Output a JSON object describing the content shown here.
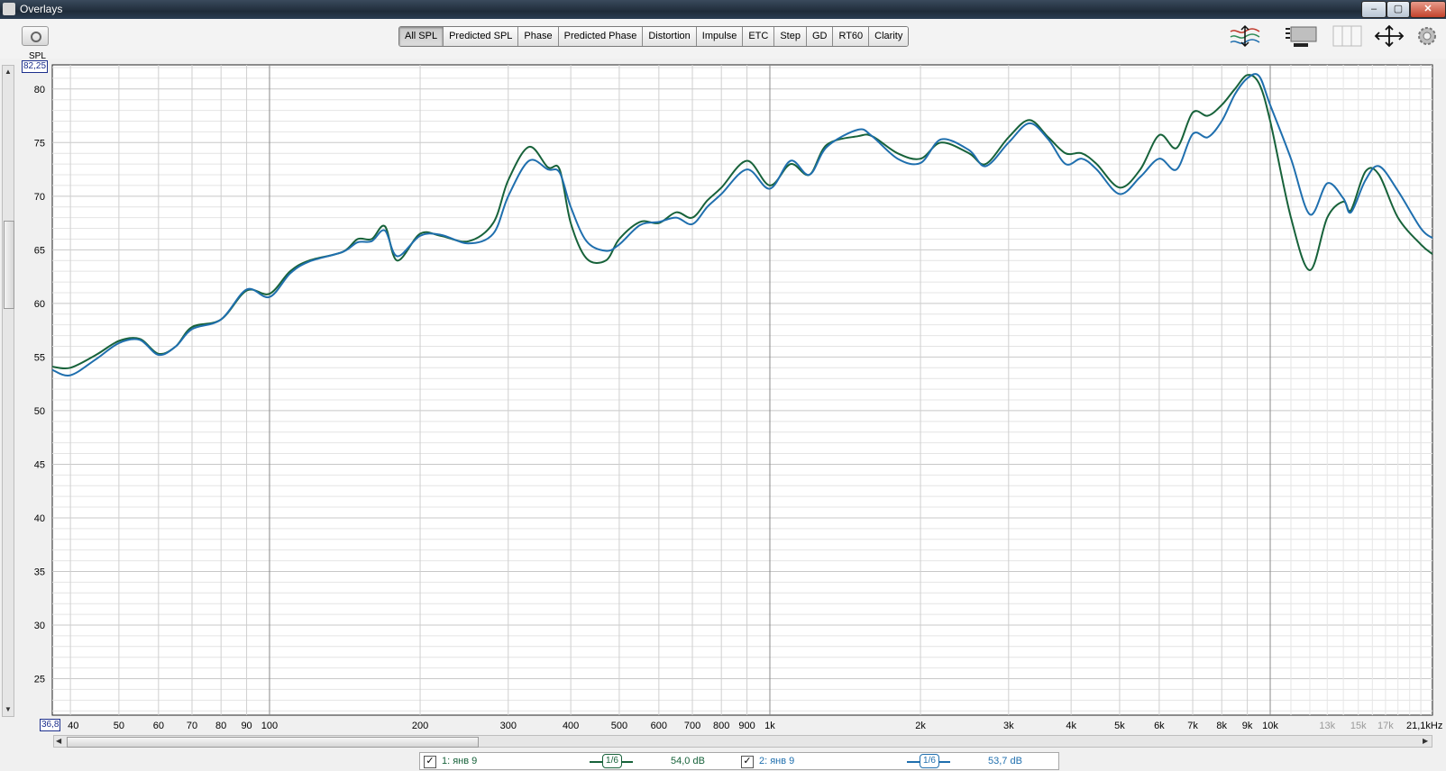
{
  "window": {
    "title": "Overlays",
    "minimize": "–",
    "maximize": "▢",
    "close": "✕"
  },
  "tabs": [
    {
      "label": "All SPL",
      "active": true
    },
    {
      "label": "Predicted SPL"
    },
    {
      "label": "Phase"
    },
    {
      "label": "Predicted Phase"
    },
    {
      "label": "Distortion"
    },
    {
      "label": "Impulse"
    },
    {
      "label": "ETC"
    },
    {
      "label": "Step"
    },
    {
      "label": "GD"
    },
    {
      "label": "RT60"
    },
    {
      "label": "Clarity"
    }
  ],
  "toolbar_icons": [
    "camera-icon",
    "trace-arrange-icon",
    "controls-panel-icon",
    "columns-icon",
    "fit-arrows-icon",
    "gear-icon"
  ],
  "y_axis": {
    "label": "SPL",
    "top_value": "82,25"
  },
  "x_axis": {
    "start_value": "36,8",
    "end_label": "21,1kHz"
  },
  "legend": [
    {
      "checked": true,
      "name": "1: янв 9",
      "smoothing": "1/6",
      "level": "54,0 dB",
      "color": "#17623a"
    },
    {
      "checked": true,
      "name": "2: янв 9",
      "smoothing": "1/6",
      "level": "53,7 dB",
      "color": "#1f6fae"
    }
  ],
  "chart_data": {
    "type": "line",
    "x_scale": "log",
    "xlim": [
      36.8,
      21100
    ],
    "ylim": [
      21.6,
      82.25
    ],
    "y_ticks": [
      25,
      30,
      35,
      40,
      45,
      50,
      55,
      60,
      65,
      70,
      75,
      80
    ],
    "x_tick_labels": [
      {
        "v": 40,
        "t": "40"
      },
      {
        "v": 50,
        "t": "50"
      },
      {
        "v": 60,
        "t": "60"
      },
      {
        "v": 70,
        "t": "70"
      },
      {
        "v": 80,
        "t": "80"
      },
      {
        "v": 90,
        "t": "90"
      },
      {
        "v": 100,
        "t": "100"
      },
      {
        "v": 200,
        "t": "200"
      },
      {
        "v": 300,
        "t": "300"
      },
      {
        "v": 400,
        "t": "400"
      },
      {
        "v": 500,
        "t": "500"
      },
      {
        "v": 600,
        "t": "600"
      },
      {
        "v": 700,
        "t": "700"
      },
      {
        "v": 800,
        "t": "800"
      },
      {
        "v": 900,
        "t": "900"
      },
      {
        "v": 1000,
        "t": "1k"
      },
      {
        "v": 2000,
        "t": "2k"
      },
      {
        "v": 3000,
        "t": "3k"
      },
      {
        "v": 4000,
        "t": "4k"
      },
      {
        "v": 5000,
        "t": "5k"
      },
      {
        "v": 6000,
        "t": "6k"
      },
      {
        "v": 7000,
        "t": "7k"
      },
      {
        "v": 8000,
        "t": "8k"
      },
      {
        "v": 9000,
        "t": "9k"
      },
      {
        "v": 10000,
        "t": "10k"
      },
      {
        "v": 13000,
        "t": "13k",
        "dim": true
      },
      {
        "v": 15000,
        "t": "15k",
        "dim": true
      },
      {
        "v": 17000,
        "t": "17k",
        "dim": true
      }
    ],
    "series": [
      {
        "name": "1: янв 9",
        "color": "#17623a",
        "points": [
          [
            36.8,
            54.1
          ],
          [
            40,
            54.0
          ],
          [
            45,
            55.2
          ],
          [
            50,
            56.5
          ],
          [
            55,
            56.7
          ],
          [
            60,
            55.3
          ],
          [
            65,
            56.0
          ],
          [
            70,
            57.8
          ],
          [
            80,
            58.5
          ],
          [
            90,
            61.2
          ],
          [
            100,
            60.9
          ],
          [
            110,
            63.0
          ],
          [
            120,
            64.0
          ],
          [
            140,
            64.8
          ],
          [
            150,
            66.0
          ],
          [
            160,
            66.0
          ],
          [
            170,
            67.2
          ],
          [
            180,
            64.0
          ],
          [
            200,
            66.5
          ],
          [
            220,
            66.3
          ],
          [
            250,
            65.8
          ],
          [
            280,
            67.5
          ],
          [
            300,
            71.5
          ],
          [
            330,
            74.6
          ],
          [
            360,
            72.7
          ],
          [
            380,
            72.5
          ],
          [
            400,
            67.5
          ],
          [
            430,
            64.2
          ],
          [
            470,
            64.0
          ],
          [
            500,
            66.0
          ],
          [
            550,
            67.6
          ],
          [
            600,
            67.5
          ],
          [
            650,
            68.5
          ],
          [
            700,
            68.0
          ],
          [
            750,
            69.6
          ],
          [
            800,
            70.8
          ],
          [
            900,
            73.3
          ],
          [
            1000,
            71.0
          ],
          [
            1100,
            73.0
          ],
          [
            1200,
            72.0
          ],
          [
            1300,
            74.8
          ],
          [
            1500,
            75.6
          ],
          [
            1600,
            75.6
          ],
          [
            1800,
            74.0
          ],
          [
            2000,
            73.5
          ],
          [
            2200,
            75.0
          ],
          [
            2500,
            74.0
          ],
          [
            2700,
            73.0
          ],
          [
            3000,
            75.5
          ],
          [
            3300,
            77.1
          ],
          [
            3600,
            75.5
          ],
          [
            3900,
            74.0
          ],
          [
            4200,
            74.0
          ],
          [
            4500,
            73.0
          ],
          [
            5000,
            70.8
          ],
          [
            5500,
            72.5
          ],
          [
            6000,
            75.7
          ],
          [
            6500,
            74.5
          ],
          [
            7000,
            77.8
          ],
          [
            7500,
            77.5
          ],
          [
            8000,
            78.5
          ],
          [
            8500,
            80.0
          ],
          [
            9000,
            81.3
          ],
          [
            9500,
            80.5
          ],
          [
            10000,
            77.0
          ],
          [
            11000,
            68.0
          ],
          [
            12000,
            63.1
          ],
          [
            13000,
            68.0
          ],
          [
            14000,
            69.5
          ],
          [
            14500,
            68.7
          ],
          [
            15500,
            72.3
          ],
          [
            16500,
            72.0
          ],
          [
            18000,
            68.0
          ],
          [
            20000,
            65.5
          ],
          [
            21100,
            64.6
          ]
        ]
      },
      {
        "name": "2: янв 9",
        "color": "#1f6fae",
        "points": [
          [
            36.8,
            53.8
          ],
          [
            40,
            53.3
          ],
          [
            45,
            54.8
          ],
          [
            50,
            56.3
          ],
          [
            55,
            56.6
          ],
          [
            60,
            55.2
          ],
          [
            65,
            56.0
          ],
          [
            70,
            57.6
          ],
          [
            80,
            58.5
          ],
          [
            90,
            61.3
          ],
          [
            100,
            60.6
          ],
          [
            110,
            62.8
          ],
          [
            120,
            63.9
          ],
          [
            140,
            64.8
          ],
          [
            150,
            65.7
          ],
          [
            160,
            65.8
          ],
          [
            170,
            66.8
          ],
          [
            180,
            64.4
          ],
          [
            200,
            66.3
          ],
          [
            220,
            66.4
          ],
          [
            250,
            65.6
          ],
          [
            280,
            66.5
          ],
          [
            300,
            70.0
          ],
          [
            330,
            73.3
          ],
          [
            360,
            72.5
          ],
          [
            380,
            72.2
          ],
          [
            400,
            69.0
          ],
          [
            430,
            65.8
          ],
          [
            470,
            64.9
          ],
          [
            500,
            65.5
          ],
          [
            550,
            67.3
          ],
          [
            600,
            67.6
          ],
          [
            650,
            68.0
          ],
          [
            700,
            67.4
          ],
          [
            750,
            69.0
          ],
          [
            800,
            70.2
          ],
          [
            900,
            72.5
          ],
          [
            1000,
            70.7
          ],
          [
            1100,
            73.3
          ],
          [
            1200,
            72.0
          ],
          [
            1300,
            74.6
          ],
          [
            1500,
            76.2
          ],
          [
            1600,
            75.6
          ],
          [
            1800,
            73.5
          ],
          [
            2000,
            73.1
          ],
          [
            2200,
            75.3
          ],
          [
            2500,
            74.3
          ],
          [
            2700,
            72.8
          ],
          [
            3000,
            75.0
          ],
          [
            3300,
            76.8
          ],
          [
            3600,
            75.3
          ],
          [
            3900,
            73.0
          ],
          [
            4200,
            73.5
          ],
          [
            4500,
            72.5
          ],
          [
            5000,
            70.2
          ],
          [
            5500,
            71.8
          ],
          [
            6000,
            73.5
          ],
          [
            6500,
            72.5
          ],
          [
            7000,
            75.8
          ],
          [
            7500,
            75.5
          ],
          [
            8000,
            77.0
          ],
          [
            8500,
            79.5
          ],
          [
            9000,
            81.0
          ],
          [
            9500,
            81.2
          ],
          [
            10000,
            78.5
          ],
          [
            11000,
            73.5
          ],
          [
            12000,
            68.3
          ],
          [
            13000,
            71.2
          ],
          [
            14000,
            69.8
          ],
          [
            14500,
            68.5
          ],
          [
            15500,
            71.5
          ],
          [
            16500,
            72.8
          ],
          [
            18000,
            70.5
          ],
          [
            20000,
            67.0
          ],
          [
            21100,
            66.1
          ]
        ]
      }
    ]
  }
}
